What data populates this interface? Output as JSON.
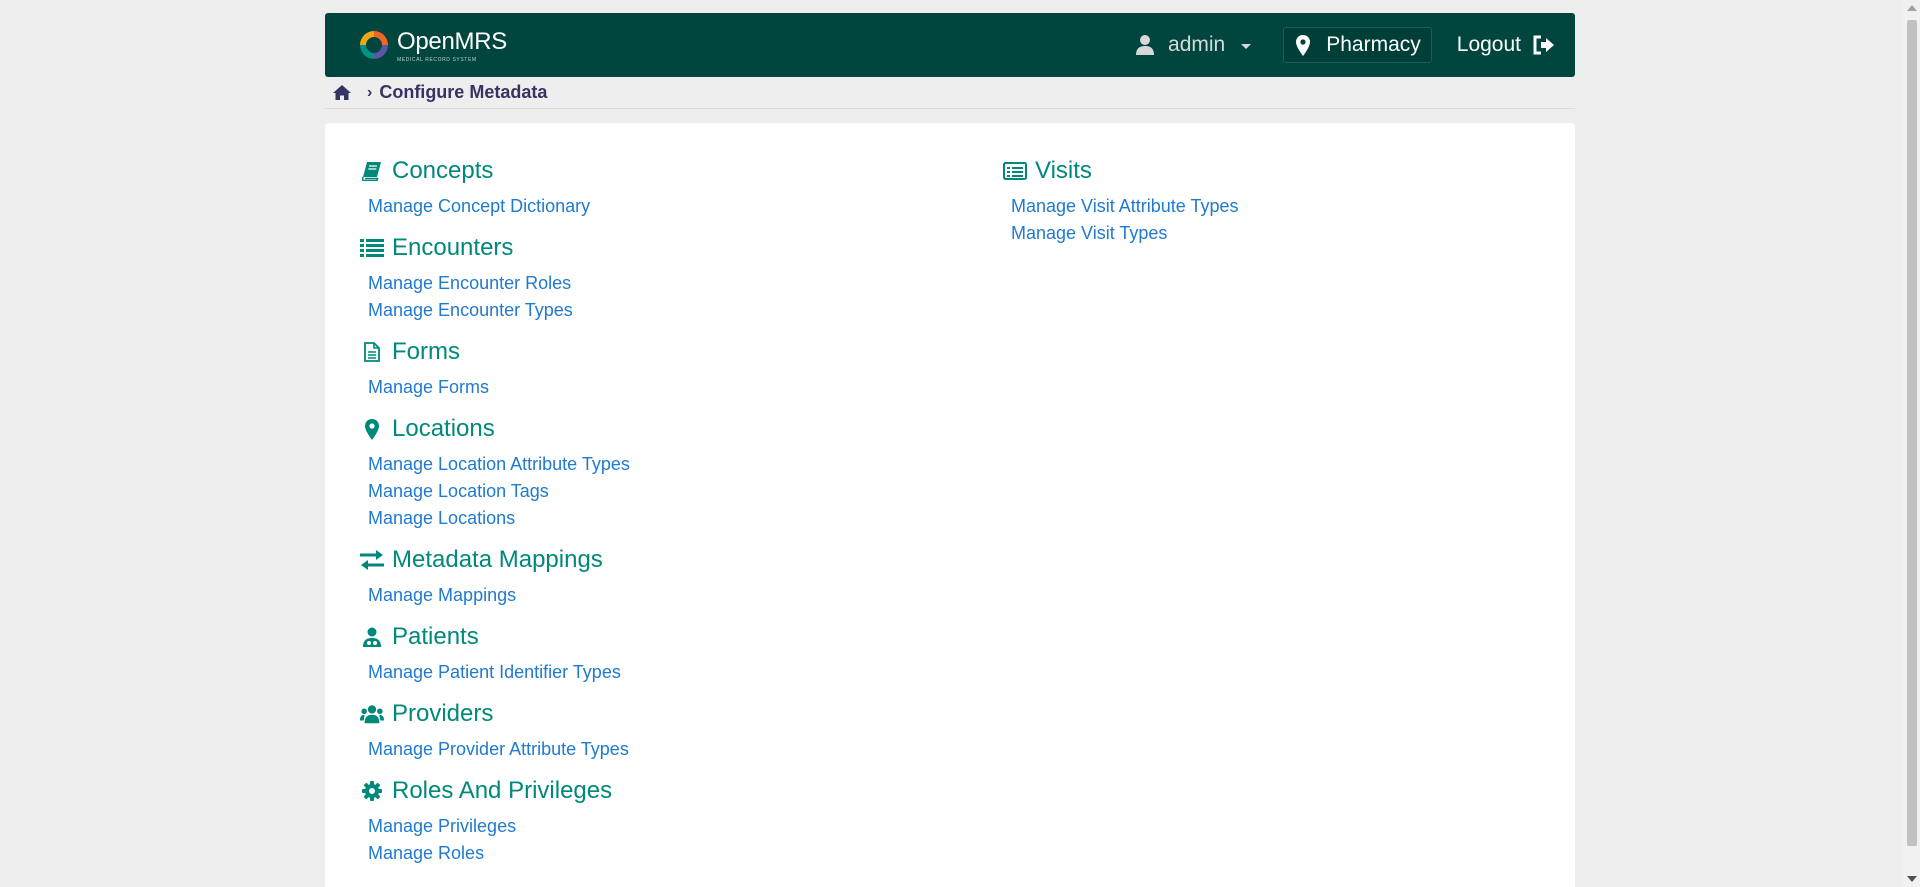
{
  "header": {
    "logo_text": "OpenMRS",
    "logo_sub": "MEDICAL RECORD SYSTEM",
    "user": "admin",
    "location": "Pharmacy",
    "logout": "Logout"
  },
  "breadcrumb": {
    "home_icon": "home-icon",
    "current": "Configure Metadata"
  },
  "colors": {
    "header_bg": "#00463f",
    "section_title": "#00897b",
    "link": "#1f7ad0",
    "page_bg": "#eeeeee"
  },
  "sections_left": [
    {
      "title": "Concepts",
      "icon": "book-icon",
      "links": [
        "Manage Concept Dictionary"
      ]
    },
    {
      "title": "Encounters",
      "icon": "list-icon",
      "links": [
        "Manage Encounter Roles",
        "Manage Encounter Types"
      ]
    },
    {
      "title": "Forms",
      "icon": "file-icon",
      "links": [
        "Manage Forms"
      ]
    },
    {
      "title": "Locations",
      "icon": "map-marker-icon",
      "links": [
        "Manage Location Attribute Types",
        "Manage Location Tags",
        "Manage Locations"
      ]
    },
    {
      "title": "Metadata Mappings",
      "icon": "exchange-icon",
      "links": [
        "Manage Mappings"
      ]
    },
    {
      "title": "Patients",
      "icon": "user-md-icon",
      "links": [
        "Manage Patient Identifier Types"
      ]
    },
    {
      "title": "Providers",
      "icon": "users-icon",
      "links": [
        "Manage Provider Attribute Types"
      ]
    },
    {
      "title": "Roles And Privileges",
      "icon": "gear-icon",
      "links": [
        "Manage Privileges",
        "Manage Roles"
      ]
    }
  ],
  "sections_right": [
    {
      "title": "Visits",
      "icon": "list-alt-icon",
      "links": [
        "Manage Visit Attribute Types",
        "Manage Visit Types"
      ]
    }
  ]
}
